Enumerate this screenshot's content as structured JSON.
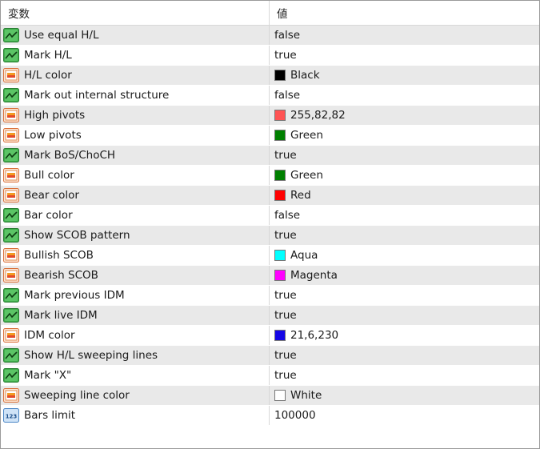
{
  "header": {
    "name_label": "変数",
    "value_label": "値"
  },
  "rows": [
    {
      "name": "Use equal H/L",
      "value": "false",
      "icon": "bool-icon"
    },
    {
      "name": "Mark H/L",
      "value": "true",
      "icon": "bool-icon"
    },
    {
      "name": "H/L color",
      "value": "Black",
      "icon": "color-icon",
      "swatch": "#000000"
    },
    {
      "name": "Mark out internal structure",
      "value": "false",
      "icon": "bool-icon"
    },
    {
      "name": "High pivots",
      "value": "255,82,82",
      "icon": "color-icon",
      "swatch": "#ff5252"
    },
    {
      "name": "Low pivots",
      "value": "Green",
      "icon": "color-icon",
      "swatch": "#008000"
    },
    {
      "name": "Mark BoS/ChoCH",
      "value": "true",
      "icon": "bool-icon"
    },
    {
      "name": "Bull color",
      "value": "Green",
      "icon": "color-icon",
      "swatch": "#008000"
    },
    {
      "name": "Bear color",
      "value": "Red",
      "icon": "color-icon",
      "swatch": "#ff0000"
    },
    {
      "name": "Bar color",
      "value": "false",
      "icon": "bool-icon"
    },
    {
      "name": "Show SCOB pattern",
      "value": "true",
      "icon": "bool-icon"
    },
    {
      "name": "Bullish SCOB",
      "value": "Aqua",
      "icon": "color-icon",
      "swatch": "#00ffff"
    },
    {
      "name": "Bearish SCOB",
      "value": "Magenta",
      "icon": "color-icon",
      "swatch": "#ff00ff"
    },
    {
      "name": "Mark previous IDM",
      "value": "true",
      "icon": "bool-icon"
    },
    {
      "name": "Mark live IDM",
      "value": "true",
      "icon": "bool-icon"
    },
    {
      "name": "IDM color",
      "value": "21,6,230",
      "icon": "color-icon",
      "swatch": "#1506e6"
    },
    {
      "name": "Show H/L sweeping lines",
      "value": "true",
      "icon": "bool-icon"
    },
    {
      "name": "Mark \"X\"",
      "value": "true",
      "icon": "bool-icon"
    },
    {
      "name": "Sweeping line color",
      "value": "White",
      "icon": "color-icon",
      "swatch": "#ffffff"
    },
    {
      "name": "Bars limit",
      "value": "100000",
      "icon": "number-icon"
    }
  ]
}
